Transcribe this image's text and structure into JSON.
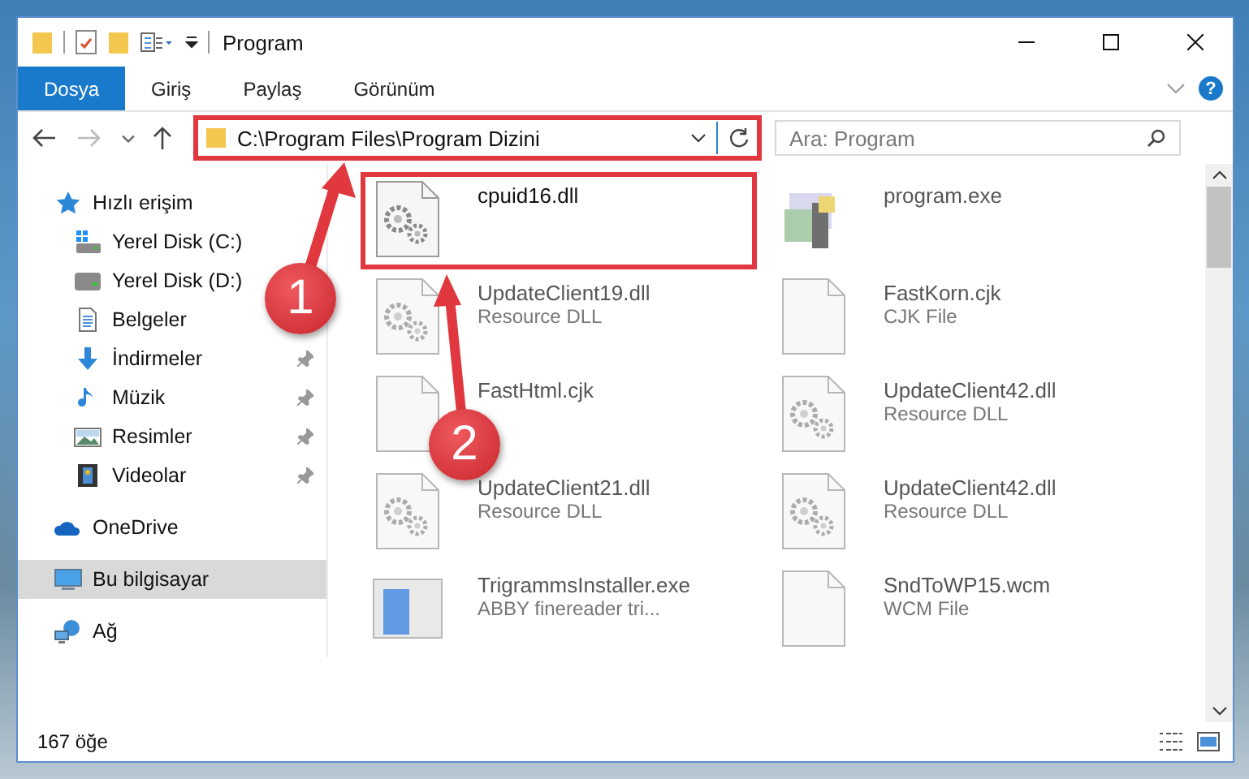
{
  "window": {
    "title": "Program"
  },
  "ribbon": {
    "tabs": [
      {
        "label": "Dosya",
        "selected": true
      },
      {
        "label": "Giriş",
        "selected": false
      },
      {
        "label": "Paylaş",
        "selected": false
      },
      {
        "label": "Görünüm",
        "selected": false
      }
    ],
    "help": "?"
  },
  "address_bar": {
    "path": "C:\\Program Files\\Program Dizini",
    "highlighted": true
  },
  "search": {
    "placeholder": "Ara: Program"
  },
  "sidebar": {
    "items": [
      {
        "label": "Hızlı erişim",
        "kind": "star",
        "selected": false,
        "children": [
          {
            "label": "Yerel Disk (C:)",
            "kind": "drive-c",
            "pinned": false,
            "selected": false
          },
          {
            "label": "Yerel Disk (D:)",
            "kind": "drive",
            "pinned": false,
            "selected": false
          },
          {
            "label": "Belgeler",
            "kind": "document",
            "pinned": false,
            "selected": false
          },
          {
            "label": "İndirmeler",
            "kind": "download",
            "pinned": true,
            "selected": false
          },
          {
            "label": "Müzik",
            "kind": "music",
            "pinned": true,
            "selected": false
          },
          {
            "label": "Resimler",
            "kind": "pictures",
            "pinned": true,
            "selected": false
          },
          {
            "label": "Videolar",
            "kind": "video",
            "pinned": true,
            "selected": false
          }
        ]
      },
      {
        "label": "OneDrive",
        "kind": "cloud",
        "selected": false
      },
      {
        "label": "Bu bilgisayar",
        "kind": "computer",
        "selected": true
      },
      {
        "label": "Ağ",
        "kind": "network",
        "selected": false
      }
    ]
  },
  "files": [
    {
      "name": "cpuid16.dll",
      "kind": "gear",
      "highlighted": true
    },
    {
      "name": "program.exe",
      "kind": "exe",
      "highlighted": false
    },
    {
      "name": "UpdateClient19.dll",
      "type": "Resource DLL",
      "kind": "gear",
      "highlighted": false
    },
    {
      "name": "FastKorn.cjk",
      "type": "CJK File",
      "kind": "blank",
      "highlighted": false
    },
    {
      "name": "FastHtml.cjk",
      "kind": "blank",
      "highlighted": false
    },
    {
      "name": "UpdateClient42.dll",
      "type": "Resource DLL",
      "kind": "gear",
      "highlighted": false
    },
    {
      "name": "UpdateClient21.dll",
      "type": "Resource DLL",
      "kind": "gear",
      "highlighted": false
    },
    {
      "name": "UpdateClient42.dll",
      "type": "Resource DLL",
      "kind": "gear",
      "highlighted": false
    },
    {
      "name": "TrigrammsInstaller.exe",
      "type": "ABBY finereader tri...",
      "kind": "installer",
      "highlighted": false
    },
    {
      "name": "SndToWP15.wcm",
      "type": "WCM File",
      "kind": "blank",
      "highlighted": false
    }
  ],
  "status_bar": {
    "count": "167 öğe"
  },
  "annotations": [
    {
      "number": "1"
    },
    {
      "number": "2"
    }
  ]
}
